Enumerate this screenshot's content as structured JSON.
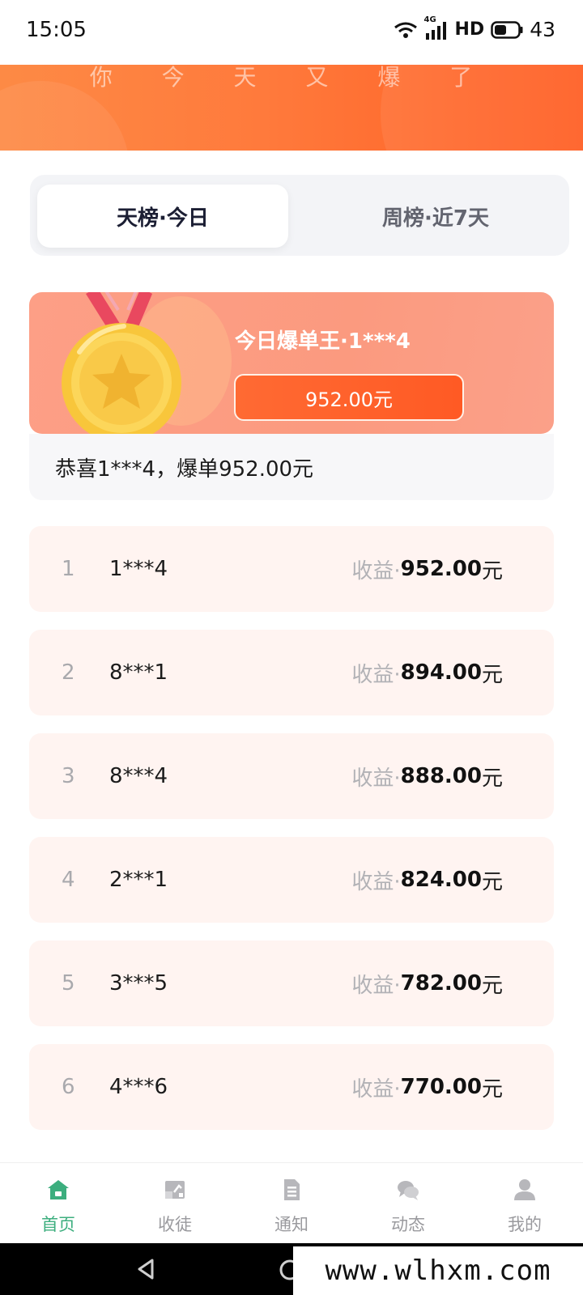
{
  "status_bar": {
    "time": "15:05",
    "network": "4G",
    "hd": "HD",
    "battery": "43"
  },
  "header": {
    "banner_text": "你 今 天 又 爆 了"
  },
  "tabs": [
    {
      "label": "天榜·今日",
      "active": true
    },
    {
      "label": "周榜·近7天",
      "active": false
    }
  ],
  "champion": {
    "title": "今日爆单王·1***4",
    "amount": "952.00元",
    "congrats": "恭喜1***4，爆单952.00元"
  },
  "ranking": {
    "earning_label": "收益·",
    "unit": "元",
    "rows": [
      {
        "rank": "1",
        "user": "1***4",
        "amount": "952.00"
      },
      {
        "rank": "2",
        "user": "8***1",
        "amount": "894.00"
      },
      {
        "rank": "3",
        "user": "8***4",
        "amount": "888.00"
      },
      {
        "rank": "4",
        "user": "2***1",
        "amount": "824.00"
      },
      {
        "rank": "5",
        "user": "3***5",
        "amount": "782.00"
      },
      {
        "rank": "6",
        "user": "4***6",
        "amount": "770.00"
      }
    ]
  },
  "bottom_nav": [
    {
      "label": "首页",
      "icon": "home-icon",
      "active": true
    },
    {
      "label": "收徒",
      "icon": "apprentice-icon",
      "active": false
    },
    {
      "label": "通知",
      "icon": "document-icon",
      "active": false
    },
    {
      "label": "动态",
      "icon": "chat-icon",
      "active": false
    },
    {
      "label": "我的",
      "icon": "user-icon",
      "active": false
    }
  ],
  "watermark": "www.wlhxm.com",
  "colors": {
    "accent": "#ff5d22",
    "nav_active": "#3cae7e",
    "row_bg": "#fff4f1"
  }
}
